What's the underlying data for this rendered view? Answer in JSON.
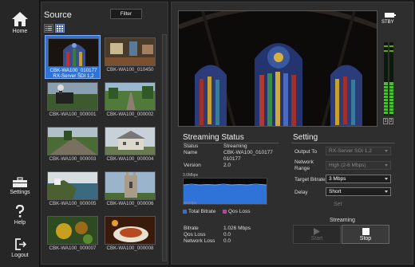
{
  "nav": {
    "home": "Home",
    "settings": "Settings",
    "help": "Help",
    "logout": "Logout"
  },
  "source": {
    "title": "Source",
    "filter_label": "Filter",
    "view_mode": "grid",
    "thumbs": [
      {
        "label": "CBK-WA100_010177\nRX-Server SDI 1,2",
        "selected": true,
        "scene": "window"
      },
      {
        "label": "CBK-WA100_010450",
        "selected": false,
        "scene": "room"
      },
      {
        "label": "CBK-WA100_000001",
        "selected": false,
        "scene": "train"
      },
      {
        "label": "CBK-WA100_000002",
        "selected": false,
        "scene": "track"
      },
      {
        "label": "CBK-WA100_000003",
        "selected": false,
        "scene": "rail"
      },
      {
        "label": "CBK-WA100_000004",
        "selected": false,
        "scene": "house"
      },
      {
        "label": "CBK-WA100_000005",
        "selected": false,
        "scene": "coast"
      },
      {
        "label": "CBK-WA100_000006",
        "selected": false,
        "scene": "church"
      },
      {
        "label": "CBK-WA100_000007",
        "selected": false,
        "scene": "garden"
      },
      {
        "label": "CBK-WA100_000008",
        "selected": false,
        "scene": "food"
      }
    ]
  },
  "preview": {
    "standby": "STBY",
    "vu_labels": [
      "1",
      "2"
    ]
  },
  "streaming_status": {
    "title": "Streaming Status",
    "status_label": "Status",
    "status_value": "Streaming",
    "name_label": "Name",
    "name_value": "CBK-WA100_010177\n010177",
    "version_label": "Version",
    "version_value": "2.0",
    "graph_top": "3.0Mbps",
    "graph_bottom": "60.0 fps",
    "legend_total": "Total Bitrate",
    "legend_qos": "Qos Loss",
    "legend_total_color": "#2f73d8",
    "legend_qos_color": "#c03ca8",
    "bitrate_label": "Bitrate",
    "bitrate_value": "1.026 Mbps",
    "qos_label": "Qos Loss",
    "qos_value": "0.0",
    "netloss_label": "Network Loss",
    "netloss_value": "0.0"
  },
  "setting": {
    "title": "Setting",
    "output_label": "Output To",
    "output_value": "RX-Server SDI 1,2",
    "range_label": "Network\nRange",
    "range_value": "High (2-6 Mbps)",
    "bitrate_label": "Target Bitrate",
    "bitrate_value": "3 Mbps",
    "delay_label": "Delay",
    "delay_value": "Short",
    "set_label": "Set"
  },
  "streaming": {
    "title": "Streaming",
    "start_label": "Start",
    "stop_label": "Stop"
  }
}
